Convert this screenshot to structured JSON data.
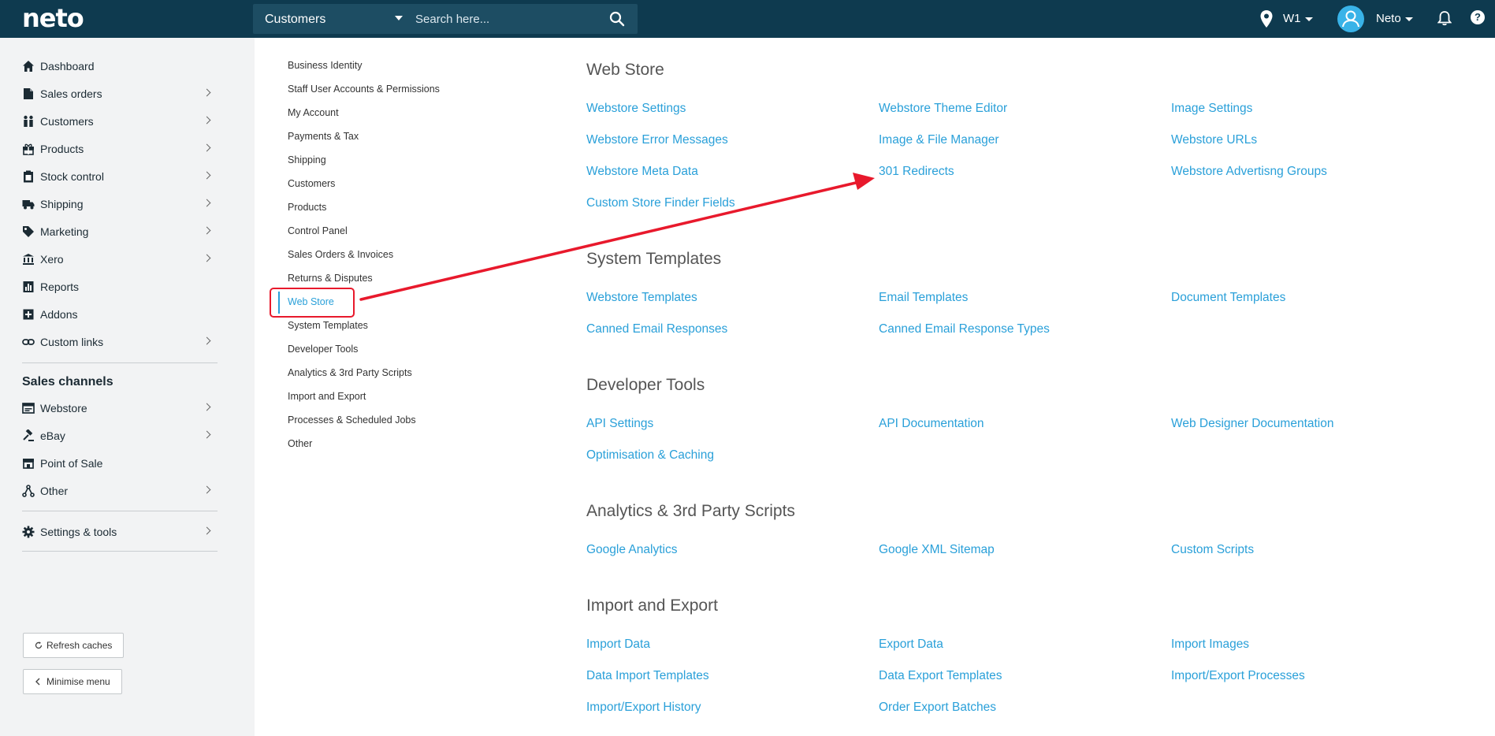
{
  "header": {
    "logo": "neto",
    "search_scope": "Customers",
    "search_placeholder": "Search here...",
    "location": "W1",
    "user": "Neto",
    "help": "?"
  },
  "sidebar": {
    "items": [
      {
        "label": "Dashboard",
        "icon": "home-icon"
      },
      {
        "label": "Sales orders",
        "icon": "document-icon"
      },
      {
        "label": "Customers",
        "icon": "users-icon"
      },
      {
        "label": "Products",
        "icon": "gift-icon"
      },
      {
        "label": "Stock control",
        "icon": "clipboard-icon"
      },
      {
        "label": "Shipping",
        "icon": "truck-icon"
      },
      {
        "label": "Marketing",
        "icon": "tag-icon"
      },
      {
        "label": "Xero",
        "icon": "bank-icon"
      },
      {
        "label": "Reports",
        "icon": "chart-icon"
      },
      {
        "label": "Addons",
        "icon": "plus-square-icon"
      },
      {
        "label": "Custom links",
        "icon": "link-icon"
      }
    ],
    "channels_title": "Sales channels",
    "channels": [
      {
        "label": "Webstore",
        "icon": "browser-icon"
      },
      {
        "label": "eBay",
        "icon": "gavel-icon"
      },
      {
        "label": "Point of Sale",
        "icon": "store-icon"
      },
      {
        "label": "Other",
        "icon": "network-icon"
      }
    ],
    "settings_label": "Settings & tools",
    "refresh_label": "Refresh caches",
    "minimise_label": "Minimise menu"
  },
  "submenu": {
    "items": [
      "Business Identity",
      "Staff User Accounts & Permissions",
      "My Account",
      "Payments & Tax",
      "Shipping",
      "Customers",
      "Products",
      "Control Panel",
      "Sales Orders & Invoices",
      "Returns & Disputes",
      "Web Store",
      "System Templates",
      "Developer Tools",
      "Analytics & 3rd Party Scripts",
      "Import and Export",
      "Processes & Scheduled Jobs",
      "Other"
    ],
    "active": "Web Store"
  },
  "sections": [
    {
      "title": "Web Store",
      "links": [
        [
          "Webstore Settings",
          "Webstore Theme Editor",
          "Image Settings"
        ],
        [
          "Webstore Error Messages",
          "Image & File Manager",
          "Webstore URLs"
        ],
        [
          "Webstore Meta Data",
          "301 Redirects",
          "Webstore Advertisng Groups"
        ],
        [
          "Custom Store Finder Fields"
        ]
      ]
    },
    {
      "title": "System Templates",
      "links": [
        [
          "Webstore Templates",
          "Email Templates",
          "Document Templates"
        ],
        [
          "Canned Email Responses",
          "Canned Email Response Types"
        ]
      ]
    },
    {
      "title": "Developer Tools",
      "links": [
        [
          "API Settings",
          "API Documentation",
          "Web Designer Documentation"
        ],
        [
          "Optimisation & Caching"
        ]
      ]
    },
    {
      "title": "Analytics & 3rd Party Scripts",
      "links": [
        [
          "Google Analytics",
          "Google XML Sitemap",
          "Custom Scripts"
        ]
      ]
    },
    {
      "title": "Import and Export",
      "links": [
        [
          "Import Data",
          "Export Data",
          "Import Images"
        ],
        [
          "Data Import Templates",
          "Data Export Templates",
          "Import/Export Processes"
        ],
        [
          "Import/Export History",
          "Order Export Batches"
        ]
      ]
    }
  ],
  "colors": {
    "header_bg": "#0e3a4f",
    "link": "#2aa0d9",
    "annotation": "#e8192c"
  }
}
